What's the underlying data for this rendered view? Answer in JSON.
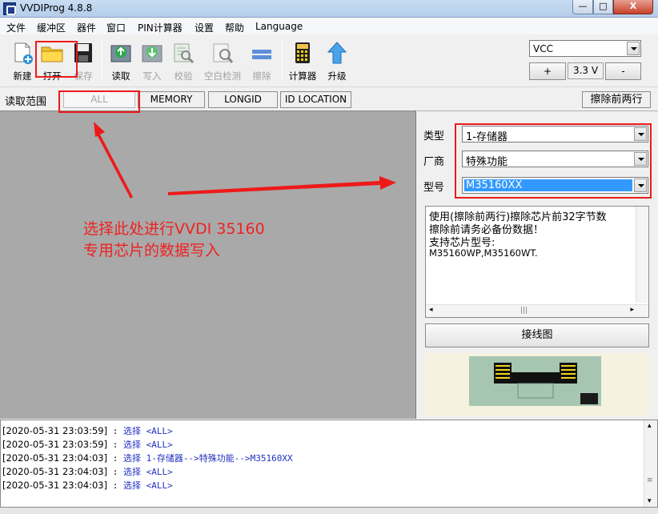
{
  "window": {
    "title": "VVDIProg 4.8.8",
    "controls": {
      "minimize": "—",
      "maximize": "□",
      "close": "X"
    }
  },
  "menu": [
    "文件",
    "缓冲区",
    "器件",
    "窗口",
    "PIN计算器",
    "设置",
    "帮助",
    "Language"
  ],
  "toolbar": {
    "new": "新建",
    "open": "打开",
    "save": "保存",
    "read": "读取",
    "write": "写入",
    "verify": "校验",
    "blank_check": "空白检测",
    "erase": "擦除",
    "calculator": "计算器",
    "upgrade": "升级"
  },
  "power": {
    "vcc_label": "VCC",
    "plus": "+",
    "voltage": "3.3 V",
    "minus": "-"
  },
  "range": {
    "label": "读取范围",
    "options": [
      "ALL",
      "MEMORY",
      "LONGID",
      "ID LOCATION"
    ],
    "selected": "ALL",
    "erase_first_two_rows": "擦除前两行"
  },
  "chip_select": {
    "type_label": "类型",
    "type_value": "1-存储器",
    "vendor_label": "厂商",
    "vendor_value": "特殊功能",
    "model_label": "型号",
    "model_value": "M35160XX"
  },
  "description": [
    "使用(擦除前两行)擦除芯片前32字节数",
    "擦除前请务必备份数据！",
    "支持芯片型号:",
    "M35160WP,M35160WT."
  ],
  "wiring_button": "接线图",
  "annotation": {
    "line1": "选择此处进行VVDI 35160",
    "line2": "专用芯片的数据写入"
  },
  "log": [
    {
      "ts": "[2020-05-31 23:03:59]",
      "msg": "选择 <ALL>"
    },
    {
      "ts": "[2020-05-31 23:03:59]",
      "msg": "选择 <ALL>"
    },
    {
      "ts": "[2020-05-31 23:04:03]",
      "msg": "选择 1-存储器-->特殊功能-->M35160XX"
    },
    {
      "ts": "[2020-05-31 23:04:03]",
      "msg": "选择 <ALL>"
    },
    {
      "ts": "[2020-05-31 23:04:03]",
      "msg": "选择 <ALL>"
    }
  ],
  "colors": {
    "annotation_red": "#ee1a1a",
    "selection_blue": "#3399ff",
    "log_blue": "#2030c0"
  }
}
